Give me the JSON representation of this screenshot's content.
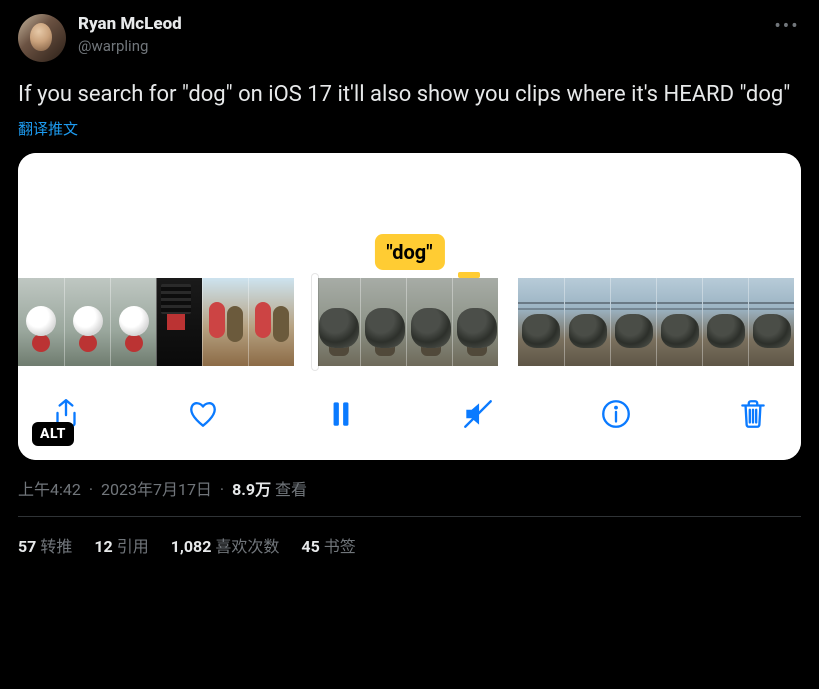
{
  "author": {
    "display_name": "Ryan McLeod",
    "handle": "@warpling"
  },
  "tweet_text": "If you search for \"dog\" on iOS 17 it'll also show you clips where it's HEARD \"dog\"",
  "translate_label": "翻译推文",
  "media": {
    "search_tag": "\"dog\"",
    "alt_badge": "ALT",
    "toolbar_icons": {
      "share": "share-icon",
      "like": "heart-icon",
      "pause": "pause-icon",
      "mute": "mute-icon",
      "info": "info-icon",
      "trash": "trash-icon"
    }
  },
  "meta": {
    "time": "上午4:42",
    "date": "2023年7月17日",
    "views_count": "8.9万",
    "views_label": "查看"
  },
  "stats": {
    "retweets": {
      "count": "57",
      "label": "转推"
    },
    "quotes": {
      "count": "12",
      "label": "引用"
    },
    "likes": {
      "count": "1,082",
      "label": "喜欢次数"
    },
    "bookmarks": {
      "count": "45",
      "label": "书签"
    }
  }
}
